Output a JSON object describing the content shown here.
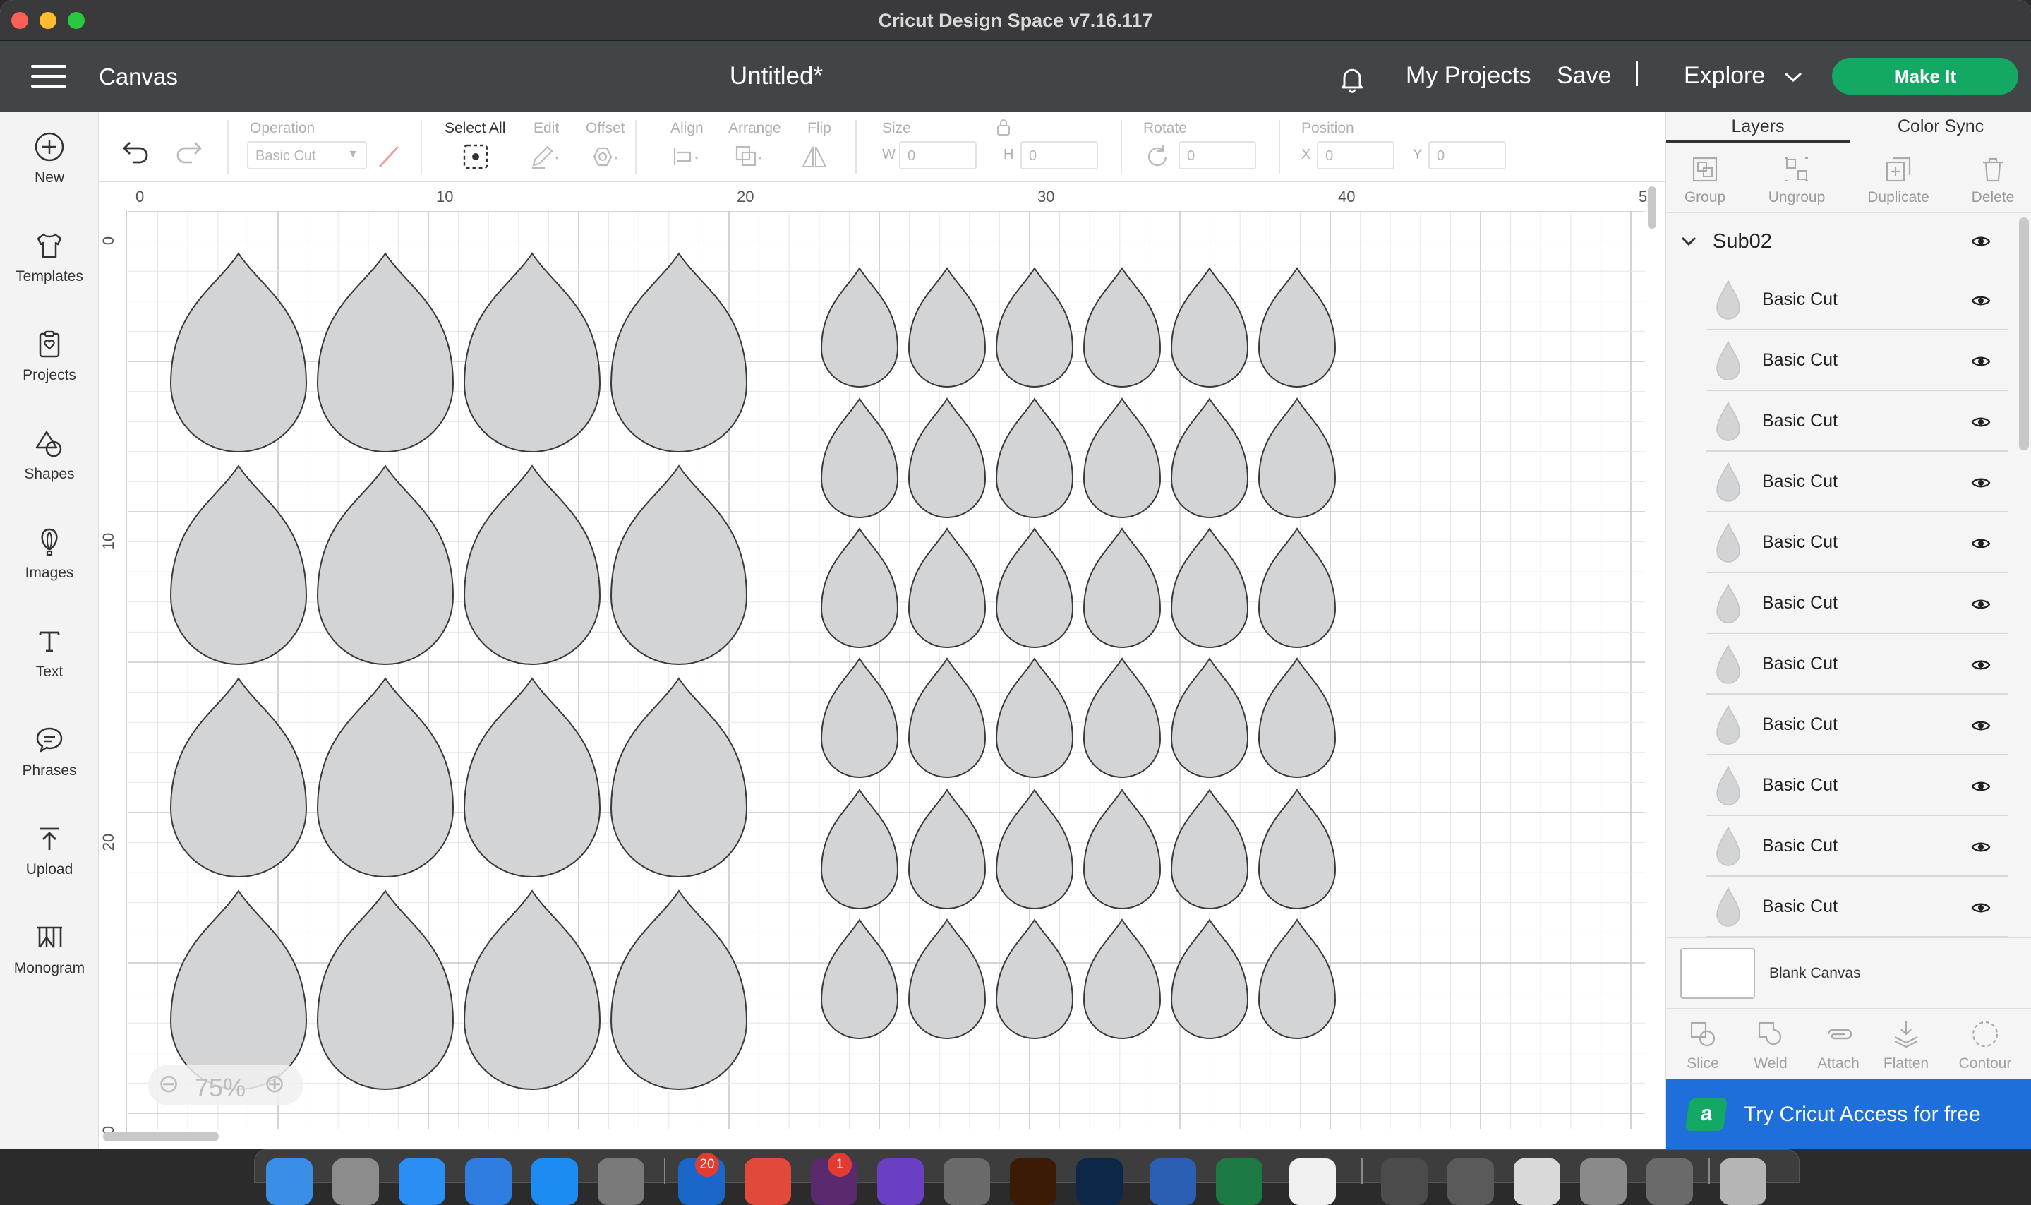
{
  "window": {
    "title": "Cricut Design Space  v7.16.117"
  },
  "header": {
    "section": "Canvas",
    "doc_title": "Untitled*",
    "my_projects": "My Projects",
    "save": "Save",
    "separator": "|",
    "explore": "Explore",
    "make_it": "Make It"
  },
  "sidebar": [
    {
      "label": "New",
      "icon": "plus-circle-icon"
    },
    {
      "label": "Templates",
      "icon": "tshirt-icon"
    },
    {
      "label": "Projects",
      "icon": "clipboard-heart-icon"
    },
    {
      "label": "Shapes",
      "icon": "shapes-icon"
    },
    {
      "label": "Images",
      "icon": "balloon-icon"
    },
    {
      "label": "Text",
      "icon": "text-t-icon"
    },
    {
      "label": "Phrases",
      "icon": "speech-bubble-icon"
    },
    {
      "label": "Upload",
      "icon": "upload-arrow-icon"
    },
    {
      "label": "Monogram",
      "icon": "monogram-icon"
    }
  ],
  "toolbar": {
    "operation_label": "Operation",
    "operation_value": "Basic Cut",
    "select_all": "Select All",
    "edit": "Edit",
    "offset": "Offset",
    "align": "Align",
    "arrange": "Arrange",
    "flip": "Flip",
    "size": "Size",
    "w_label": "W",
    "w_value": "0",
    "h_label": "H",
    "h_value": "0",
    "rotate": "Rotate",
    "rotate_value": "0",
    "position": "Position",
    "x_label": "X",
    "x_value": "0",
    "y_label": "Y",
    "y_value": "0"
  },
  "canvas": {
    "ruler_top": [
      "0",
      "10",
      "20",
      "30",
      "40",
      "5"
    ],
    "ruler_left": [
      "0",
      "10",
      "20",
      "0"
    ],
    "zoom": "75%",
    "shape_fill": "#d3d4d6",
    "shape_stroke": "#3a3a3a"
  },
  "right_panel": {
    "tabs": [
      "Layers",
      "Color Sync"
    ],
    "actions": [
      "Group",
      "Ungroup",
      "Duplicate",
      "Delete"
    ],
    "group_name": "Sub02",
    "layers": [
      "Basic Cut",
      "Basic Cut",
      "Basic Cut",
      "Basic Cut",
      "Basic Cut",
      "Basic Cut",
      "Basic Cut",
      "Basic Cut",
      "Basic Cut",
      "Basic Cut",
      "Basic Cut"
    ],
    "blank_canvas": "Blank Canvas",
    "bottom_actions": [
      "Slice",
      "Weld",
      "Attach",
      "Flatten",
      "Contour"
    ],
    "try_access": "Try Cricut Access for free",
    "access_logo": "a"
  },
  "dock": {
    "badges": [
      "20",
      "1"
    ]
  },
  "colors": {
    "accent_green": "#13a864",
    "header_bg": "#414547",
    "access_blue": "#1e6fd9"
  }
}
